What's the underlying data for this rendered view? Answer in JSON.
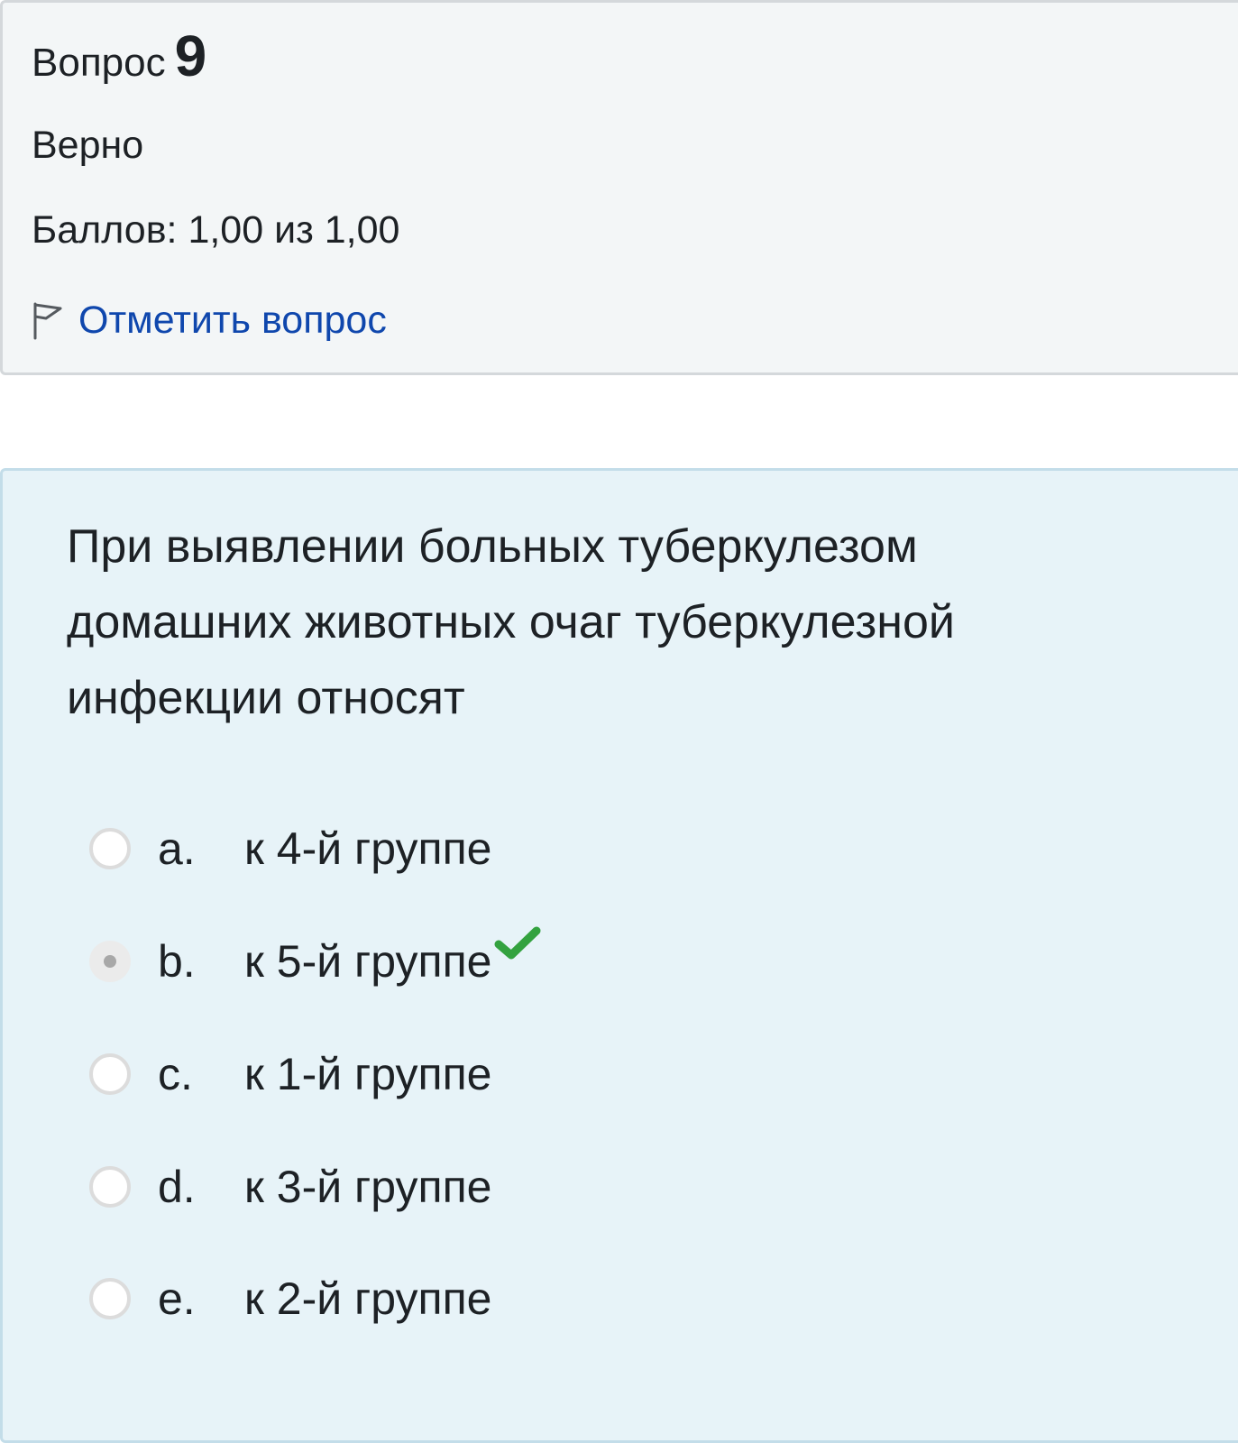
{
  "info": {
    "question_word": "Вопрос",
    "question_number": "9",
    "state": "Верно",
    "grade": "Баллов: 1,00 из 1,00",
    "flag_label": "Отметить вопрос",
    "flag_icon": "flag-icon"
  },
  "question": {
    "text": "При выявлении больных туберкулезом домашних животных очаг туберкулезной инфекции относят",
    "answers": [
      {
        "letter": "a.",
        "text": "к 4-й группе",
        "selected": false,
        "correct": false
      },
      {
        "letter": "b.",
        "text": "к 5-й группе",
        "selected": true,
        "correct": true
      },
      {
        "letter": "c.",
        "text": "к 1-й группе",
        "selected": false,
        "correct": false
      },
      {
        "letter": "d.",
        "text": "к 3-й группе",
        "selected": false,
        "correct": false
      },
      {
        "letter": "e.",
        "text": "к 2-й группе",
        "selected": false,
        "correct": false
      }
    ],
    "correct_icon": "check-icon",
    "correct_color": "#33a23f"
  },
  "colors": {
    "info_bg": "#f3f6f7",
    "content_bg": "#e7f3f8",
    "link": "#0f47ad",
    "text": "#1d2125"
  }
}
